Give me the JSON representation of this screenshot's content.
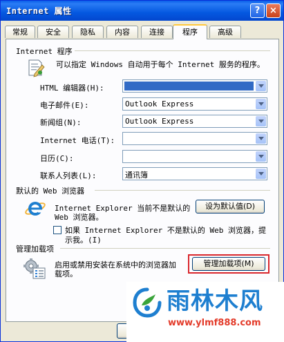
{
  "window": {
    "title": "Internet 属性",
    "help_label": "?",
    "close_label": "×"
  },
  "tabs": [
    "常规",
    "安全",
    "隐私",
    "内容",
    "连接",
    "程序",
    "高级"
  ],
  "internet_programs": {
    "group_title": "Internet 程序",
    "description": "可以指定 Windows 自动用于每个 Internet 服务的程序。",
    "rows": [
      {
        "label": "HTML 编辑器(H):",
        "value": ""
      },
      {
        "label": "电子邮件(E):",
        "value": "Outlook Express"
      },
      {
        "label": "新闻组(N):",
        "value": "Outlook Express"
      },
      {
        "label": "Internet 电话(T):",
        "value": ""
      },
      {
        "label": "日历(C):",
        "value": ""
      },
      {
        "label": "联系人列表(L):",
        "value": "通讯簿"
      }
    ]
  },
  "default_browser": {
    "group_title": "默认的 Web 浏览器",
    "line1": "Internet Explorer 当前不是默认的",
    "line2": "Web 浏览器。",
    "set_default_button": "设为默认值(D)",
    "check_line1": "如果 Internet Explorer 不是默认的 Web 浏览器，提",
    "check_line2": "示我。(I)"
  },
  "addons": {
    "group_title": "管理加载项",
    "line1": "启用或禁用安装在系统中的浏览器加",
    "line2": "载项。",
    "manage_button": "管理加载项(M)"
  },
  "watermark": {
    "brand": "雨林木风",
    "url": "www.ylmf888.com"
  },
  "colors": {
    "accent": "#0054e3",
    "highlight_border": "#d9262c",
    "brand_blue": "#1e7fd0"
  }
}
